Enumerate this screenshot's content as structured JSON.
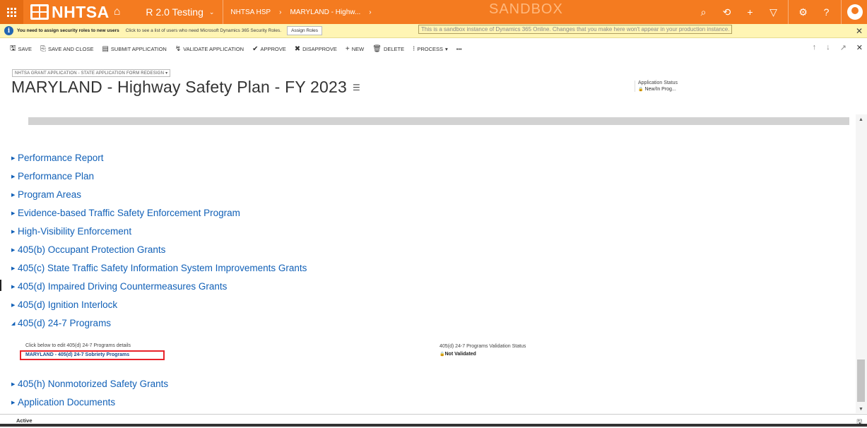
{
  "navbar": {
    "logo_text": "NHTSA",
    "app_name": "R 2.0 Testing",
    "breadcrumb": [
      "NHTSA HSP",
      "MARYLAND - Highw..."
    ],
    "sandbox_label": "SANDBOX",
    "icons": [
      "search-icon",
      "history-icon",
      "add-icon",
      "filter-icon",
      "settings-icon",
      "help-icon",
      "user-avatar"
    ]
  },
  "notification": {
    "bold_text": "You need to assign security roles to new users",
    "text": "Click to see a list of users who need Microsoft Dynamics 365 Security Roles.",
    "button_label": "Assign Roles",
    "sandbox_message": "This is a sandbox instance of Dynamics 365 Online. Changes that you make here won't appear in your production instance."
  },
  "commands": [
    {
      "label": "SAVE",
      "icon": "save-icon"
    },
    {
      "label": "SAVE AND CLOSE",
      "icon": "save-close-icon"
    },
    {
      "label": "SUBMIT APPLICATION",
      "icon": "submit-icon"
    },
    {
      "label": "VALIDATE APPLICATION",
      "icon": "validate-icon"
    },
    {
      "label": "APPROVE",
      "icon": "approve-icon"
    },
    {
      "label": "DISAPPROVE",
      "icon": "disapprove-icon"
    },
    {
      "label": "NEW",
      "icon": "plus-icon"
    },
    {
      "label": "DELETE",
      "icon": "trash-icon"
    },
    {
      "label": "PROCESS",
      "icon": "process-icon"
    },
    {
      "label": "•••",
      "icon": "more-icon"
    }
  ],
  "header": {
    "form_selector": "NHTSA GRANT APPLICATION - STATE APPLICATION FORM REDESIGN",
    "title": "MARYLAND - Highway Safety Plan - FY 2023",
    "status_label": "Application Status",
    "status_value": "New/In Prog..."
  },
  "sections": [
    {
      "label": "Performance Report",
      "expanded": false
    },
    {
      "label": "Performance Plan",
      "expanded": false
    },
    {
      "label": "Program Areas",
      "expanded": false
    },
    {
      "label": "Evidence-based Traffic Safety Enforcement Program",
      "expanded": false
    },
    {
      "label": "High-Visibility Enforcement",
      "expanded": false
    },
    {
      "label": "405(b) Occupant Protection Grants",
      "expanded": false
    },
    {
      "label": "405(c) State Traffic Safety Information System Improvements Grants",
      "expanded": false
    },
    {
      "label": "405(d) Impaired Driving Countermeasures Grants",
      "expanded": false
    },
    {
      "label": "405(d) Ignition Interlock",
      "expanded": false
    },
    {
      "label": "405(d) 24-7 Programs",
      "expanded": true
    },
    {
      "label": "405(h) Nonmotorized Safety Grants",
      "expanded": false
    },
    {
      "label": "Application Documents",
      "expanded": false
    }
  ],
  "programs_24_7": {
    "edit_label": "Click below to edit 405(d) 24-7 Programs details",
    "link_text": "MARYLAND - 405(d) 24-7 Sobriety Programs",
    "validation_label": "405(d) 24-7 Programs Validation Status",
    "validation_value": "Not Validated"
  },
  "footer": {
    "status": "Active"
  }
}
